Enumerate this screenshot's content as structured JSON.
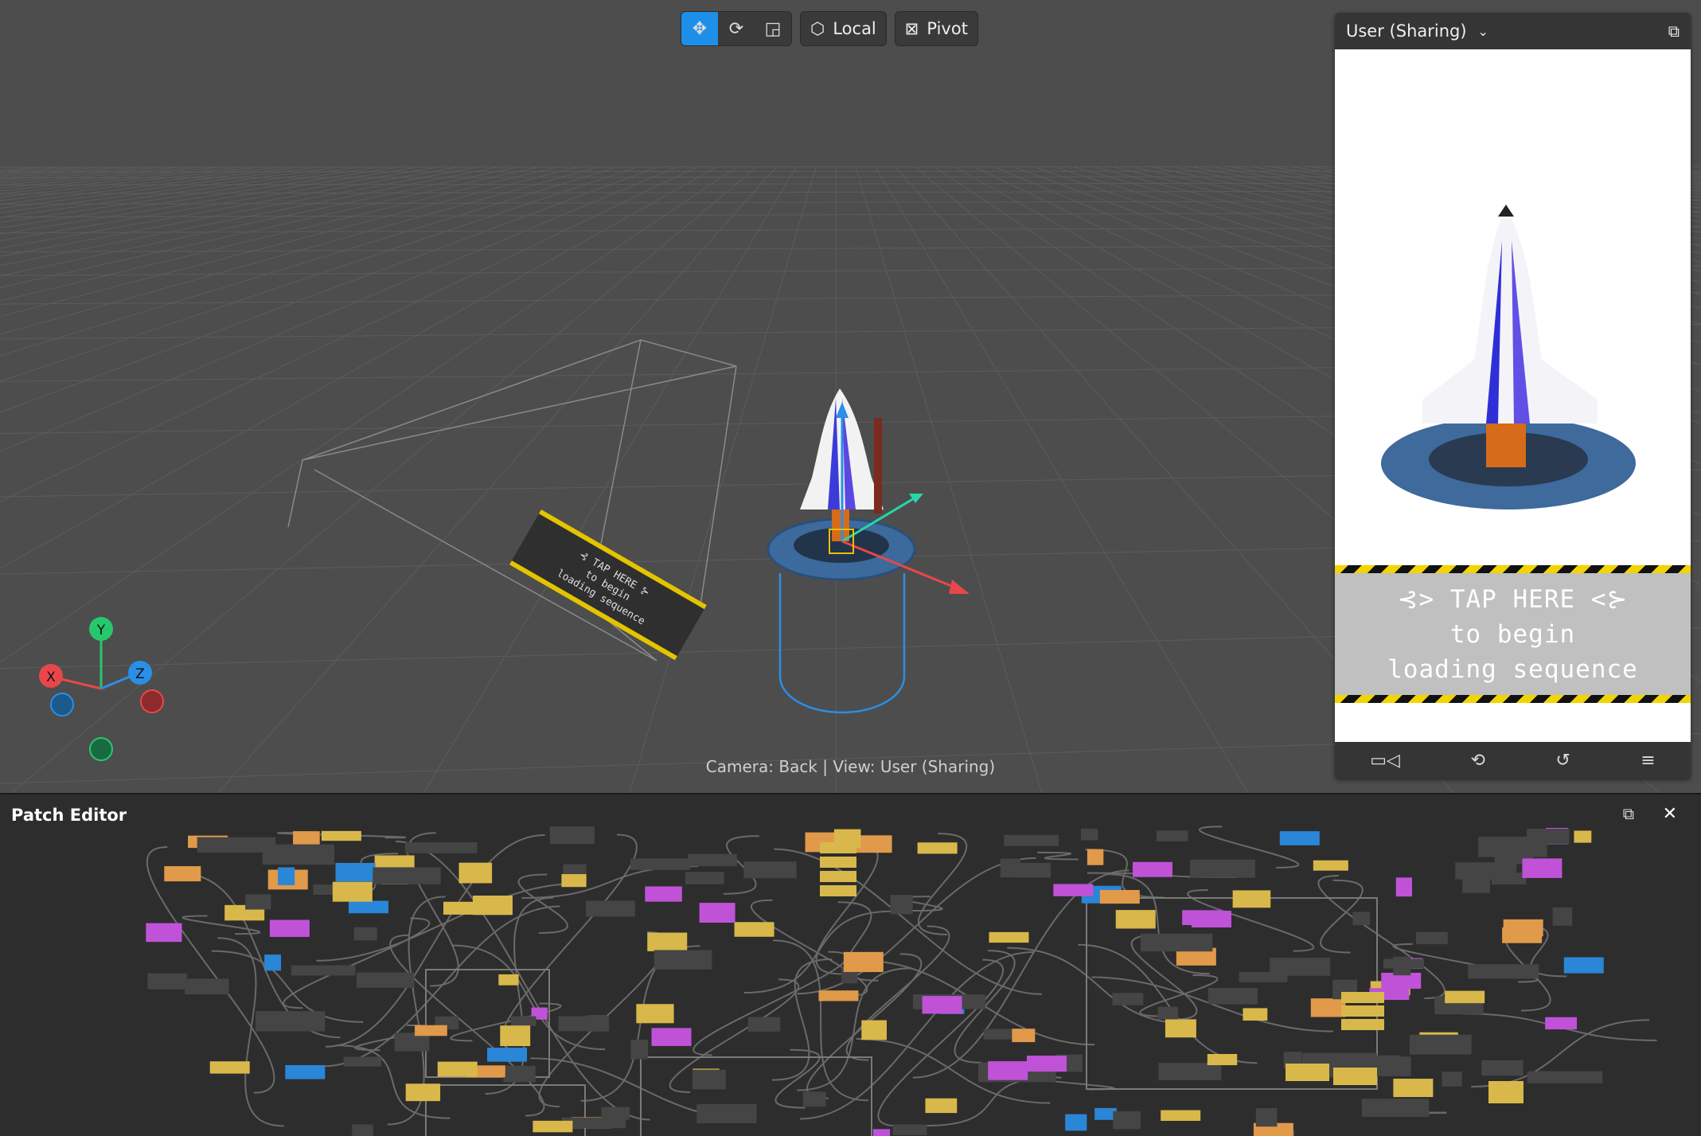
{
  "toolbar": {
    "move_icon": "move-arrows-icon",
    "rotate_icon": "rotate-icon",
    "scale_icon": "scale-icon",
    "local_label": "Local",
    "pivot_label": "Pivot",
    "active_tool": "move",
    "accent": "#1e8fe8"
  },
  "viewport": {
    "camera_status": "Camera: Back | View: User (Sharing)",
    "sign_line1": "⊰ TAP HERE ⊱",
    "sign_line2": "to begin",
    "sign_line3": "loading sequence",
    "gizmo": {
      "x": "X",
      "y": "Y",
      "z": "Z"
    },
    "axis_colors": {
      "x": "#e8474a",
      "y": "#27c86b",
      "z": "#2a8fe6"
    }
  },
  "preview": {
    "device_label": "User (Sharing)",
    "banner_line1": "⊰> TAP HERE <⊱",
    "banner_line2": "to begin",
    "banner_line3": "loading sequence",
    "footer_icons": [
      "video-camera-icon",
      "flip-camera-icon",
      "rotate-device-icon",
      "menu-icon"
    ]
  },
  "patch_editor": {
    "title": "Patch Editor",
    "node_colors": {
      "yellow": "#d8b84a",
      "orange": "#e09a4a",
      "blue": "#2a86d6",
      "purple": "#c052d8",
      "gray": "#454545"
    }
  }
}
